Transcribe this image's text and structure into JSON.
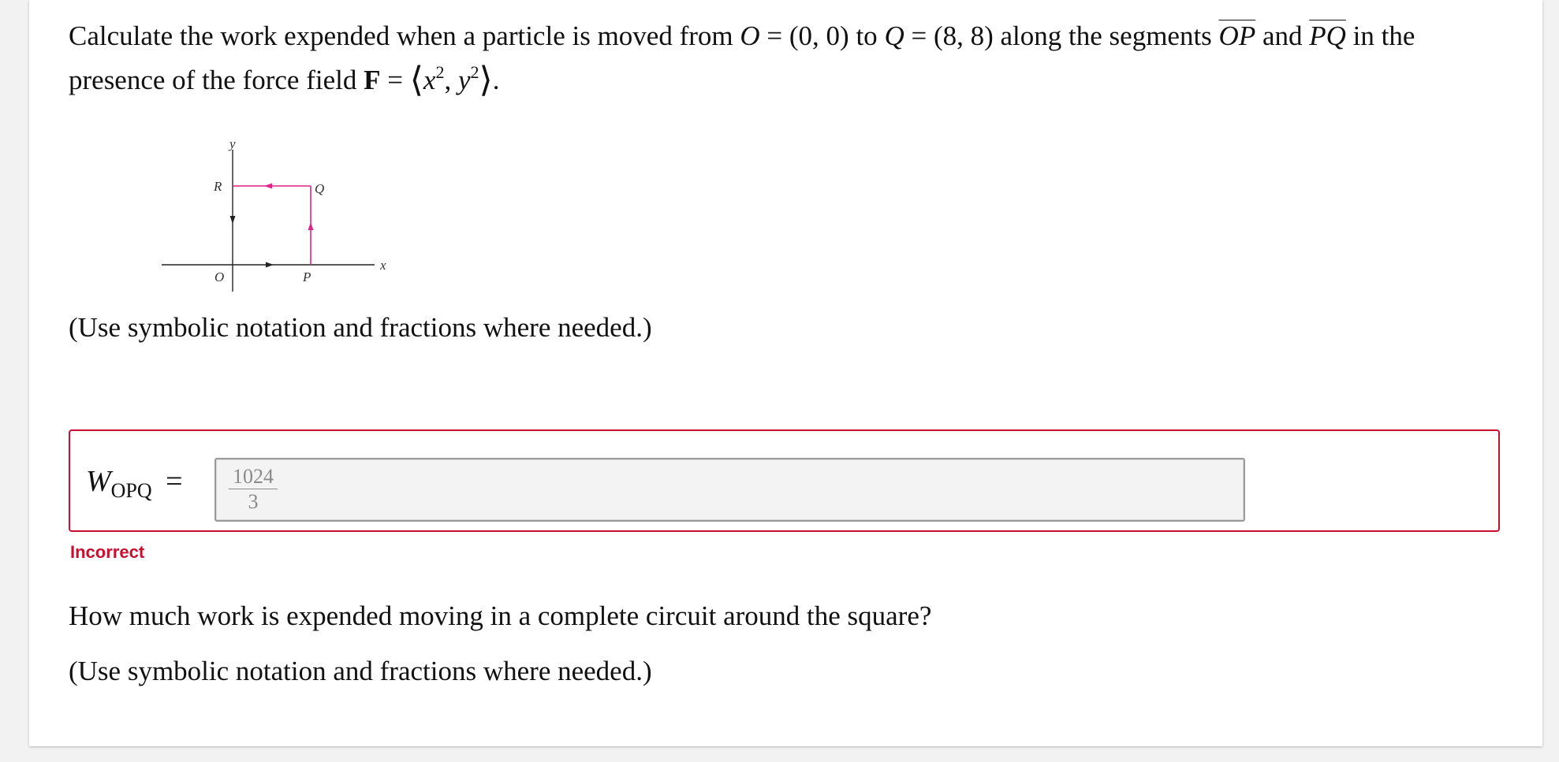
{
  "question": {
    "line1": {
      "pre": "Calculate the work expended when a particle is moved from ",
      "O": "O",
      "eq1": " = (0, 0) to ",
      "Q": "Q",
      "eq2": " = (8, 8) along the segments ",
      "seg1": "OP",
      "and": " and ",
      "seg2": "PQ",
      "post": " in the"
    },
    "line2": {
      "pre": "presence of the force field ",
      "F": "F",
      "eq": " = ",
      "lang": "⟨",
      "x": "x",
      "exp1": "2",
      "comma": ", ",
      "y": "y",
      "exp2": "2",
      "rang": "⟩",
      "end": "."
    },
    "hint1": "(Use symbolic notation and fractions where needed.)"
  },
  "diagram": {
    "labels": {
      "y": "y",
      "x": "x",
      "R": "R",
      "Q": "Q",
      "O": "O",
      "P": "P"
    },
    "path_color": "#e0238a",
    "axis_color": "#222222"
  },
  "answer1": {
    "label_W": "W",
    "label_sub": "OPQ",
    "label_eq": "=",
    "numerator": "1024",
    "denominator": "3",
    "status": "Incorrect",
    "status_color": "#c8102e"
  },
  "question2": {
    "text": "How much work is expended moving in a complete circuit around the square?",
    "hint": "(Use symbolic notation and fractions where needed.)"
  }
}
